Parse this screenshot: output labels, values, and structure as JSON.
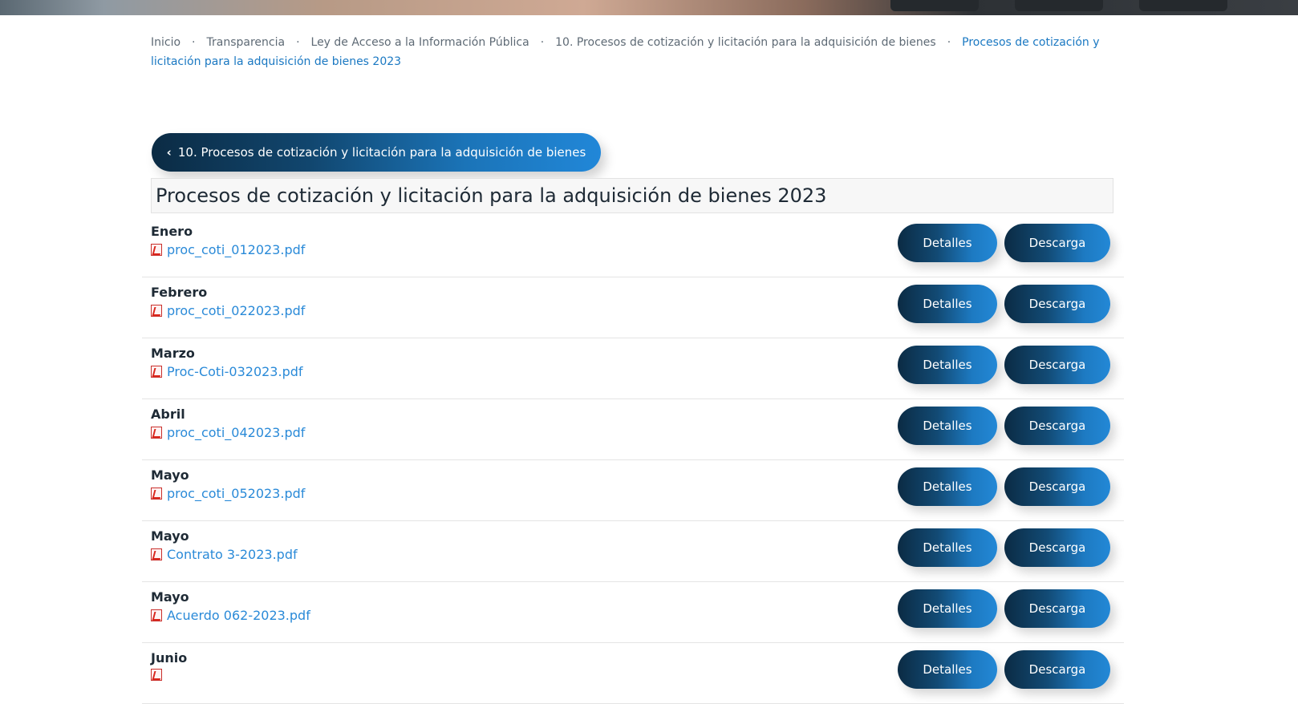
{
  "breadcrumb": {
    "items": [
      "Inicio",
      "Transparencia",
      "Ley de Acceso a la Información Pública",
      "10. Procesos de cotización y licitación para la adquisición de bienes"
    ],
    "separator": "·",
    "current": "Procesos de cotización y licitación para la adquisición de bienes 2023"
  },
  "back_button": {
    "icon": "chevron-left-icon",
    "label": "10. Procesos de cotización y licitación para la adquisición de bienes"
  },
  "page_title": "Procesos de cotización y licitación para la adquisición de bienes 2023",
  "documents": [
    {
      "month": "Enero",
      "file": "proc_coti_012023.pdf"
    },
    {
      "month": "Febrero",
      "file": "proc_coti_022023.pdf"
    },
    {
      "month": "Marzo",
      "file": "Proc-Coti-032023.pdf"
    },
    {
      "month": "Abril",
      "file": "proc_coti_042023.pdf"
    },
    {
      "month": "Mayo",
      "file": "proc_coti_052023.pdf"
    },
    {
      "month": "Mayo",
      "file": "Contrato 3-2023.pdf"
    },
    {
      "month": "Mayo",
      "file": "Acuerdo 062-2023.pdf"
    },
    {
      "month": "Junio",
      "file": ""
    }
  ],
  "actions": {
    "details_label": "Detalles",
    "download_label": "Descarga"
  },
  "colors": {
    "link": "#2a8ad8",
    "breadcrumb_current": "#1a78c2",
    "button_gradient_start": "#0b2b44",
    "button_gradient_end": "#2388d6"
  }
}
